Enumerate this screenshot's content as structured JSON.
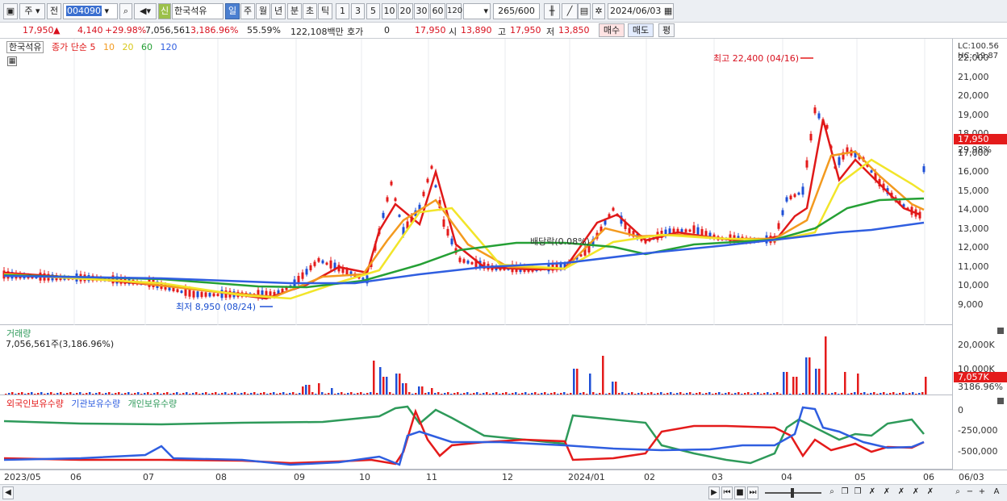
{
  "toolbar": {
    "market": "주",
    "type": "전",
    "code": "004090",
    "badge": "신",
    "name": "한국석유",
    "periods": [
      "일",
      "주",
      "월",
      "년",
      "분",
      "초",
      "틱"
    ],
    "nums": [
      "1",
      "3",
      "5",
      "10",
      "20",
      "30",
      "60",
      "120"
    ],
    "count": "265",
    "count_max": "/600",
    "date": "2024/06/03"
  },
  "quote": {
    "price": "17,950",
    "change": "4,140",
    "change_pct": "+29.98%",
    "volume": "7,056,561",
    "vol_pct": "3,186.96%",
    "turnover": "55.59%",
    "amount": "122,108백만",
    "hoga_label": "호가",
    "hoga_value": "0",
    "ask_price": "17,950",
    "open_label": "시",
    "open": "13,890",
    "high_label": "고",
    "high": "17,950",
    "low_label": "저",
    "low": "13,850",
    "buy": "매수",
    "sell": "매도",
    "eval": "평"
  },
  "price_pane": {
    "stock": "한국석유",
    "ma_label": "종가 단순 5",
    "ma10": "10",
    "ma20": "20",
    "ma60": "60",
    "ma120": "120",
    "lc": "LC:100.56",
    "hc": "HC:-19.87",
    "y_ticks": [
      "22,000",
      "21,000",
      "20,000",
      "19,000",
      "18,000",
      "17,000",
      "16,000",
      "15,000",
      "14,000",
      "13,000",
      "12,000",
      "11,000",
      "10,000",
      "9,000"
    ],
    "current_price": "17,950",
    "current_pct": "29.98%",
    "high_note": "최고 22,400 (04/16)",
    "low_note": "최저 8,950 (08/24)",
    "div_note": "배당락(0.08%)"
  },
  "volume_pane": {
    "title": "거래량",
    "value": "7,056,561주(3,186.96%)",
    "y_ticks": [
      "20,000K",
      "10,000K"
    ],
    "current": "7,057K",
    "current_pct": "3186.96%"
  },
  "holder_pane": {
    "series": [
      "외국인보유수량",
      "기관보유수량",
      "개인보유수량"
    ],
    "y_ticks": [
      "0",
      "-250,000",
      "-500,000"
    ]
  },
  "x_labels": [
    "2023/05",
    "06",
    "07",
    "08",
    "09",
    "10",
    "11",
    "12",
    "2024/01",
    "02",
    "03",
    "04",
    "05",
    "06",
    "06/03"
  ],
  "colors": {
    "up": "#e41b1b",
    "down": "#1e4fd6",
    "ma5": "#e01919",
    "ma10": "#f39a1f",
    "ma20": "#f2e52a",
    "ma60": "#25a035",
    "ma120": "#2f5ee0",
    "foreign": "#e41b1b",
    "institution": "#2f5ee0",
    "individual": "#2e9a5a"
  }
}
